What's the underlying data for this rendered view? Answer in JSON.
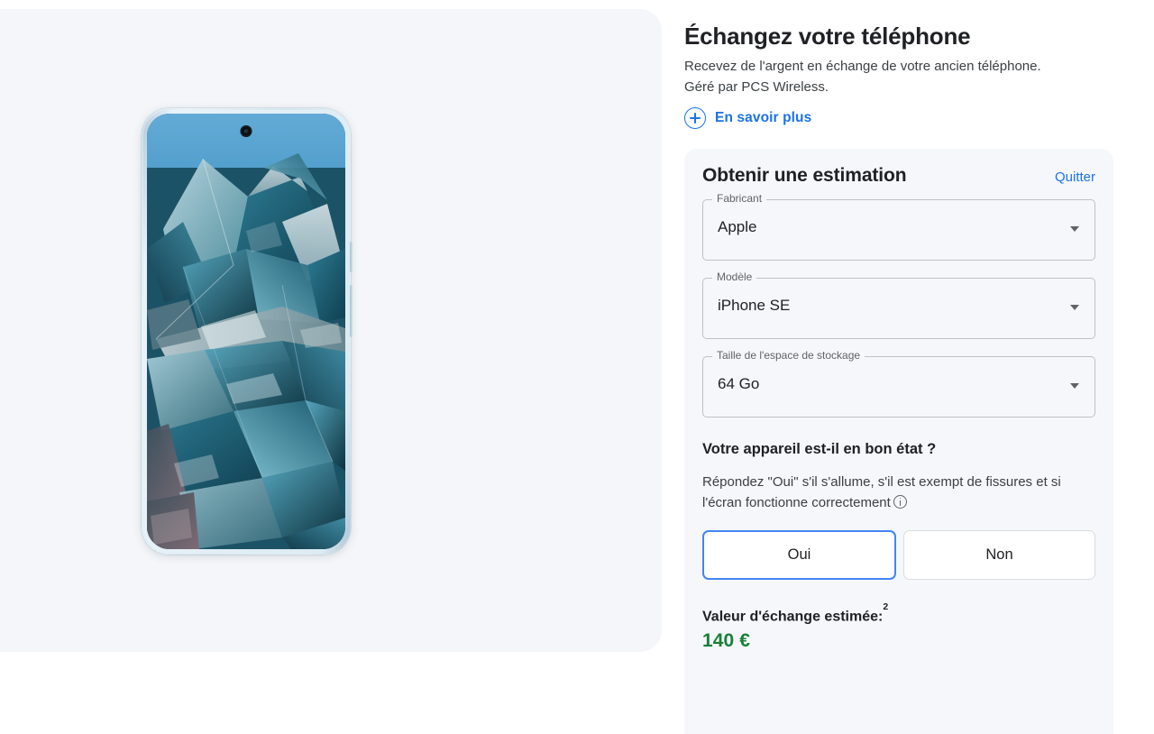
{
  "tradein": {
    "heading": "Échangez votre téléphone",
    "subtext_line1": "Recevez de l'argent en échange de votre ancien téléphone.",
    "subtext_line2": "Géré par PCS Wireless.",
    "learn_more_label": "En savoir plus",
    "learn_more_icon": "plus-circle-icon"
  },
  "estimate_card": {
    "title": "Obtenir une estimation",
    "quit_label": "Quitter",
    "fields": [
      {
        "legend": "Fabricant",
        "value": "Apple",
        "icon": "chevron-down-icon"
      },
      {
        "legend": "Modèle",
        "value": "iPhone SE",
        "icon": "chevron-down-icon"
      },
      {
        "legend": "Taille de l'espace de stockage",
        "value": "64 Go",
        "icon": "chevron-down-icon"
      }
    ],
    "condition": {
      "question": "Votre appareil est-il en bon état ?",
      "description": "Répondez \"Oui\" s'il s'allume, s'il est exempt de fissures et si l'écran fonctionne correctement",
      "info_icon": "info-circle-icon",
      "options": [
        {
          "label": "Oui",
          "selected": true
        },
        {
          "label": "Non",
          "selected": false
        }
      ]
    },
    "estimated_value": {
      "label": "Valeur d'échange estimée:",
      "footnote": "2",
      "amount": "140 €",
      "amount_color": "#188038"
    }
  },
  "device_preview": {
    "alt": "Smartphone with teal crystal wallpaper",
    "frame_color": "#d7e7f0",
    "wallpaper_colors": [
      "#5aa8d4",
      "#2e7e9e",
      "#16505f",
      "#8fc4d4",
      "#d5e4ea"
    ]
  },
  "theme": {
    "panel_background": "#f5f6f9",
    "card_background": "#f6f7fa",
    "accent_blue": "#1a73e8",
    "selected_border": "#4285f4",
    "text_primary": "#202124",
    "text_secondary": "#3c4043",
    "text_muted": "#5f6368",
    "border_grey": "#bdc1c6"
  }
}
